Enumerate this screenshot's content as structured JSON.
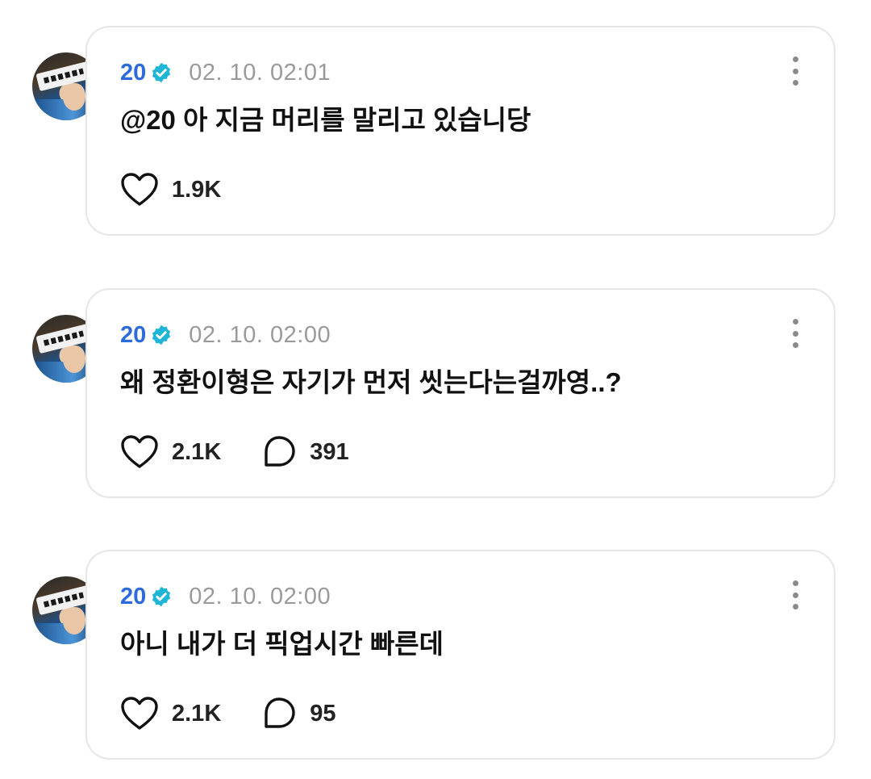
{
  "posts": [
    {
      "username": "20",
      "timestamp": "02. 10. 02:01",
      "text": "@20 아 지금 머리를 말리고 있습니당",
      "likes": "1.9K",
      "comments": null
    },
    {
      "username": "20",
      "timestamp": "02. 10. 02:00",
      "text": "왜 정환이형은 자기가 먼저 씻는다는걸까영..?",
      "likes": "2.1K",
      "comments": "391"
    },
    {
      "username": "20",
      "timestamp": "02. 10. 02:00",
      "text": "아니 내가 더 픽업시간 빠른데",
      "likes": "2.1K",
      "comments": "95"
    }
  ],
  "icons": {
    "verified": "verified-badge-icon",
    "like": "heart-icon",
    "comment": "speech-bubble-icon",
    "more": "more-vertical-icon"
  },
  "colors": {
    "username": "#2c6bd9",
    "verified_badge": "#1fb5d6",
    "timestamp": "#9a9a9a",
    "card_border": "#e6e6e6"
  }
}
